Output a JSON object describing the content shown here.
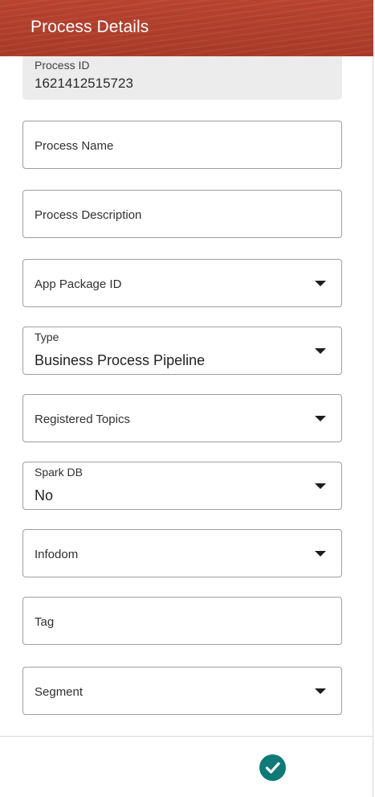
{
  "header": {
    "title": "Process Details",
    "color": "#b5412f"
  },
  "form": {
    "process_id": {
      "label": "Process ID",
      "value": "1621412515723"
    },
    "process_name": {
      "placeholder": "Process Name"
    },
    "process_description": {
      "placeholder": "Process Description"
    },
    "app_package_id": {
      "placeholder": "App Package ID",
      "icon": "chevron-down-icon"
    },
    "type": {
      "label": "Type",
      "value": "Business Process Pipeline",
      "icon": "chevron-down-icon"
    },
    "registered_topics": {
      "placeholder": "Registered Topics",
      "icon": "chevron-down-icon"
    },
    "spark_db": {
      "label": "Spark DB",
      "value": "No",
      "icon": "chevron-down-icon"
    },
    "infodom": {
      "placeholder": "Infodom",
      "icon": "chevron-down-icon"
    },
    "tag": {
      "placeholder": "Tag"
    },
    "segment": {
      "placeholder": "Segment",
      "icon": "chevron-down-icon"
    }
  },
  "footer": {
    "confirm_icon": "checkmark-icon",
    "confirm_color": "#0f7a77"
  }
}
